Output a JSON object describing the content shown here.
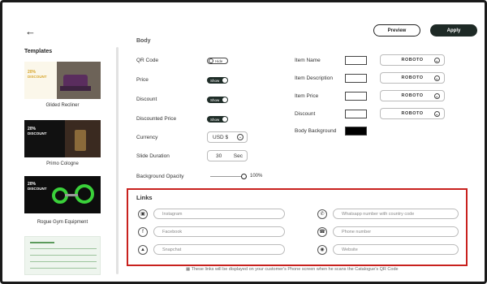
{
  "header": {
    "back_icon": "arrow-left-icon",
    "preview_label": "Preview",
    "apply_label": "Apply"
  },
  "sidebar": {
    "title": "Templates",
    "templates": [
      {
        "label": "Glided Recliner",
        "promo_line1": "20%",
        "promo_line2": "DISCOUNT"
      },
      {
        "label": "Primo Cologne",
        "promo_line1": "20%",
        "promo_line2": "DISCOUNT"
      },
      {
        "label": "Rogue Gym Equipment",
        "promo_line1": "20%",
        "promo_line2": "DISCOUNT"
      },
      {
        "label": ""
      }
    ]
  },
  "body_section": {
    "heading": "Body",
    "qr_code": {
      "label": "QR Code",
      "state": "Hide"
    },
    "price": {
      "label": "Price",
      "state": "Show"
    },
    "discount": {
      "label": "Discount",
      "state": "Show"
    },
    "discounted_price": {
      "label": "Discounted Price",
      "state": "Show"
    },
    "currency": {
      "label": "Currency",
      "value": "USD $"
    },
    "slide_duration": {
      "label": "Slide Duration",
      "value": "30",
      "unit": "Sec"
    },
    "background_opacity": {
      "label": "Background Opacity",
      "value": "100%"
    }
  },
  "styles": {
    "item_name": {
      "label": "Item Name",
      "font": "ROBOTO"
    },
    "item_description": {
      "label": "Item Description",
      "font": "ROBOTO"
    },
    "item_price": {
      "label": "Item Price",
      "font": "ROBOTO"
    },
    "discount": {
      "label": "Discount",
      "font": "ROBOTO"
    },
    "body_background": {
      "label": "Body Background",
      "color": "#000000"
    }
  },
  "links": {
    "title": "Links",
    "instagram_placeholder": "Instagram",
    "facebook_placeholder": "Facebook",
    "snapchat_placeholder": "Snapchat",
    "whatsapp_placeholder": "Whatsapp number with country code",
    "phone_placeholder": "Phone number",
    "website_placeholder": "Website",
    "footnote": "These links will be displayed on your customer's Phone screen when he scans the Catalogue's QR Code"
  },
  "colors": {
    "accent_dark": "#1e2a26",
    "highlight_border": "#c8211e"
  }
}
